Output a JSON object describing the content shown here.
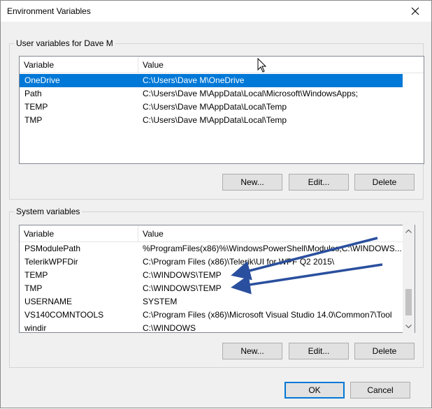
{
  "window": {
    "title": "Environment Variables"
  },
  "user_group": {
    "label": "User variables for Dave M",
    "columns": {
      "variable": "Variable",
      "value": "Value"
    },
    "rows": [
      {
        "variable": "OneDrive",
        "value": "C:\\Users\\Dave M\\OneDrive",
        "selected": true
      },
      {
        "variable": "Path",
        "value": "C:\\Users\\Dave M\\AppData\\Local\\Microsoft\\WindowsApps;"
      },
      {
        "variable": "TEMP",
        "value": "C:\\Users\\Dave M\\AppData\\Local\\Temp"
      },
      {
        "variable": "TMP",
        "value": "C:\\Users\\Dave M\\AppData\\Local\\Temp"
      }
    ],
    "buttons": {
      "new": "New...",
      "edit": "Edit...",
      "delete": "Delete"
    }
  },
  "system_group": {
    "label": "System variables",
    "columns": {
      "variable": "Variable",
      "value": "Value"
    },
    "rows": [
      {
        "variable": "PSModulePath",
        "value": "%ProgramFiles(x86)%\\WindowsPowerShell\\Modules;C:\\WINDOWS..."
      },
      {
        "variable": "TelerikWPFDir",
        "value": "C:\\Program Files (x86)\\Telerik\\UI for WPF Q2 2015\\"
      },
      {
        "variable": "TEMP",
        "value": "C:\\WINDOWS\\TEMP"
      },
      {
        "variable": "TMP",
        "value": "C:\\WINDOWS\\TEMP"
      },
      {
        "variable": "USERNAME",
        "value": "SYSTEM"
      },
      {
        "variable": "VS140COMNTOOLS",
        "value": "C:\\Program Files (x86)\\Microsoft Visual Studio 14.0\\Common7\\Tool"
      },
      {
        "variable": "windir",
        "value": "C:\\WINDOWS"
      }
    ],
    "buttons": {
      "new": "New...",
      "edit": "Edit...",
      "delete": "Delete"
    }
  },
  "footer": {
    "ok": "OK",
    "cancel": "Cancel"
  },
  "colors": {
    "selection": "#0078d7",
    "annotation_arrow": "#2a4f9e"
  },
  "icons": {
    "close": "close-icon",
    "cursor": "mouse-cursor-icon",
    "scroll_up": "scroll-up-arrow-icon",
    "scroll_down": "scroll-down-arrow-icon"
  }
}
